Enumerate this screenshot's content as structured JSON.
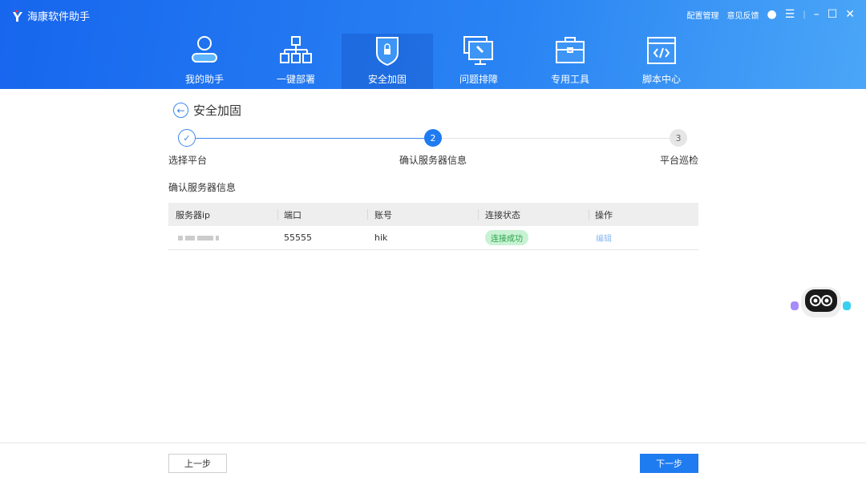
{
  "app": {
    "title": "海康软件助手",
    "config": "配置管理",
    "feedback": "意见反馈"
  },
  "tabs": [
    {
      "label": "我的助手"
    },
    {
      "label": "一键部署"
    },
    {
      "label": "安全加固"
    },
    {
      "label": "问题排障"
    },
    {
      "label": "专用工具"
    },
    {
      "label": "脚本中心"
    }
  ],
  "page": {
    "title": "安全加固",
    "subtitle": "确认服务器信息"
  },
  "steps": [
    {
      "num": "✓",
      "label": "选择平台"
    },
    {
      "num": "2",
      "label": "确认服务器信息"
    },
    {
      "num": "3",
      "label": "平台巡检"
    }
  ],
  "table": {
    "headers": [
      "服务器ip",
      "端口",
      "账号",
      "连接状态",
      "操作"
    ],
    "rows": [
      {
        "port": "55555",
        "account": "hik",
        "status": "连接成功",
        "action": "编辑"
      }
    ]
  },
  "footer": {
    "prev": "上一步",
    "next": "下一步"
  },
  "colors": {
    "accent": "#1f7bf0",
    "success": "#2aa34a"
  }
}
